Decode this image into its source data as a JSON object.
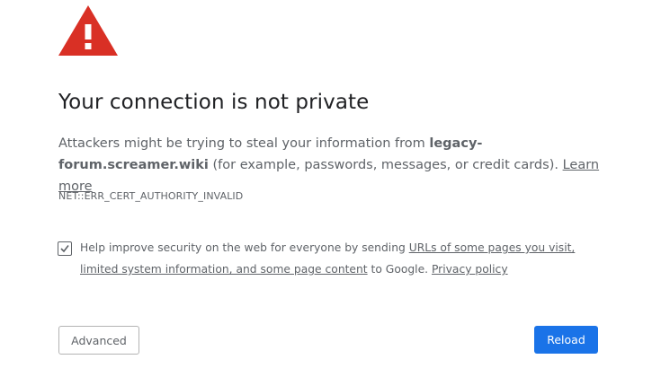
{
  "icon": {
    "name": "warning-triangle-icon",
    "color": "#d93025"
  },
  "title": "Your connection is not private",
  "description": {
    "part1": "Attackers might be trying to steal your information from ",
    "domain": "legacy-forum.screamer.wiki",
    "part2": " (for example, passwords, messages, or credit cards). ",
    "learn_more": "Learn more"
  },
  "error_code": "NET::ERR_CERT_AUTHORITY_INVALID",
  "optin": {
    "checked": true,
    "text1": "Help improve security on the web for everyone by sending ",
    "link1": "URLs of some pages you visit, limited system information, and some page content",
    "text2": " to Google. ",
    "link2": "Privacy policy"
  },
  "buttons": {
    "advanced": "Advanced",
    "reload": "Reload"
  },
  "colors": {
    "accent": "#1a73e8",
    "text": "#5f6368",
    "heading": "#202124",
    "warning": "#d93025"
  }
}
